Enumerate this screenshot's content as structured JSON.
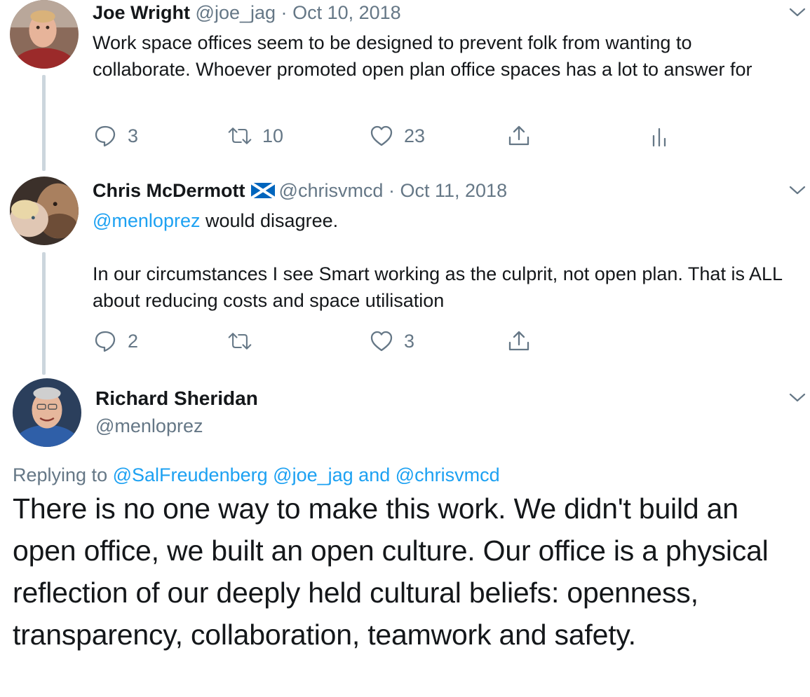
{
  "tweets": [
    {
      "name": "Joe Wright",
      "handle": "@joe_jag",
      "separator": "·",
      "date": "Oct 10, 2018",
      "text": "Work space offices seem to be designed to prevent folk from wanting to collaborate. Whoever promoted open plan office spaces has a lot to answer for",
      "replies": "3",
      "retweets": "10",
      "likes": "23"
    },
    {
      "name": "Chris McDermott",
      "flag_icon": "scotland-flag-icon",
      "handle": "@chrisvmcd",
      "separator": "·",
      "date": "Oct 11, 2018",
      "mention": "@menloprez",
      "text_line1": " would disagree.",
      "text_para2": "In our circumstances I see Smart working as the culprit, not open plan. That is ALL about reducing costs and space utilisation",
      "replies": "2",
      "retweets": "",
      "likes": "3"
    }
  ],
  "main_tweet": {
    "name": "Richard Sheridan",
    "handle": "@menloprez",
    "replying_prefix": "Replying to ",
    "replying_mentions": [
      "@SalFreudenberg",
      "@joe_jag",
      "and",
      "@chrisvmcd"
    ],
    "text": "There is no one way to make this work. We didn't build an open office,  we built an open culture. Our office is a physical reflection of our  deeply held cultural beliefs: openness, transparency, collaboration,  teamwork and safety."
  },
  "colors": {
    "link": "#1da1f2",
    "secondary": "#657786",
    "thread_line": "#ccd6dd",
    "text": "#14171a"
  }
}
